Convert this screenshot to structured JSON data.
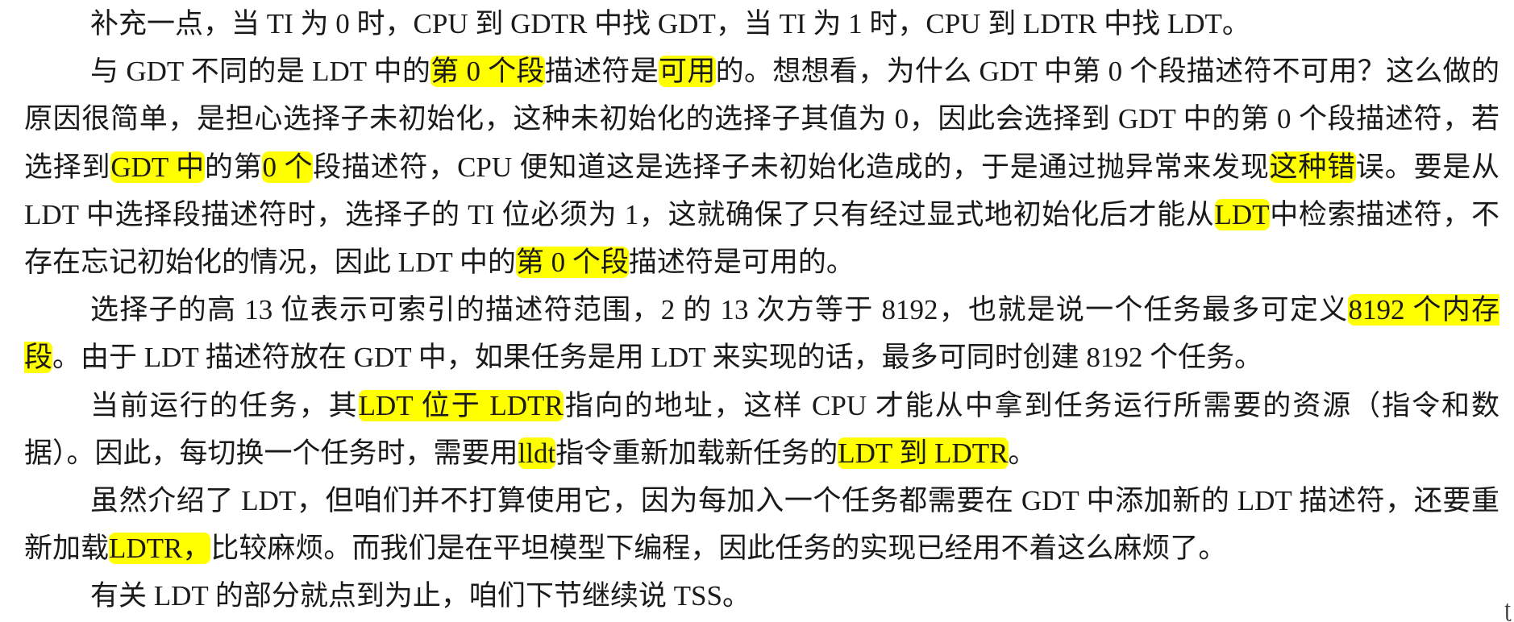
{
  "highlight_color": "#ffff00",
  "paragraphs": [
    {
      "segments": [
        {
          "text": "补充一点，当 TI 为 0 时，CPU 到 GDTR 中找 GDT，当 TI 为 1 时，CPU 到 LDTR 中找 LDT。",
          "hl": false
        }
      ]
    },
    {
      "segments": [
        {
          "text": "与 GDT 不同的是 LDT 中的",
          "hl": false
        },
        {
          "text": "第 0 个段",
          "hl": true
        },
        {
          "text": "描述符是",
          "hl": false
        },
        {
          "text": "可用",
          "hl": true
        },
        {
          "text": "的。想想看，为什么 GDT 中第 0 个段描述符不可用？这么做的原因很简单，是担心选择子未初始化，这种未初始化的选择子其值为 0，因此会选择到 GDT 中的第 0 个段描述符，若选择到",
          "hl": false
        },
        {
          "text": "GDT 中",
          "hl": true
        },
        {
          "text": "的第",
          "hl": false
        },
        {
          "text": "0 个",
          "hl": true
        },
        {
          "text": "段描述符，CPU 便知道这是选择子未初始化造成的，于是通过抛异常来发现",
          "hl": false
        },
        {
          "text": "这种错",
          "hl": true
        },
        {
          "text": "误。要是从 LDT 中选择段描述符时，选择子的 TI 位必须为 1，这就确保了只有经过显式地初始化后才能从",
          "hl": false
        },
        {
          "text": "LDT",
          "hl": true
        },
        {
          "text": "中检索描述符，不存在忘记初始化的情况，因此 LDT 中的",
          "hl": false
        },
        {
          "text": "第 0 个段",
          "hl": true
        },
        {
          "text": "描述符是可用的。",
          "hl": false
        }
      ]
    },
    {
      "segments": [
        {
          "text": "选择子的高 13 位表示可索引的描述符范围，2 的 13 次方等于 8192，也就是说一个任务最多可定义",
          "hl": false
        },
        {
          "text": "8192 个内存段",
          "hl": true
        },
        {
          "text": "。由于 LDT 描述符放在 GDT 中，如果任务是用 LDT 来实现的话，最多可同时创建 8192 个任务。",
          "hl": false
        }
      ]
    },
    {
      "segments": [
        {
          "text": "当前运行的任务，其",
          "hl": false
        },
        {
          "text": "LDT 位于 LDTR",
          "hl": true
        },
        {
          "text": "指向的地址，这样 CPU 才能从中拿到任务运行所需要的资源（指令和数据）。因此，每切换一个任务时，需要用",
          "hl": false
        },
        {
          "text": "lldt",
          "hl": true
        },
        {
          "text": "指令重新加载新任务的",
          "hl": false
        },
        {
          "text": "LDT 到 LDTR",
          "hl": true
        },
        {
          "text": "。",
          "hl": false
        }
      ]
    },
    {
      "segments": [
        {
          "text": "虽然介绍了 LDT，但咱们并不打算使用它，因为每加入一个任务都需要在 GDT 中添加新的 LDT 描述符，还要重新加载",
          "hl": false
        },
        {
          "text": "LDTR，",
          "hl": true
        },
        {
          "text": "比较麻烦。而我们是在平坦模型下编程，因此任务的实现已经用不着这么麻烦了。",
          "hl": false
        }
      ]
    },
    {
      "segments": [
        {
          "text": "有关 LDT 的部分就点到为止，咱们下节继续说 TSS。",
          "hl": false
        }
      ]
    }
  ],
  "corner_mark": "ʈ"
}
